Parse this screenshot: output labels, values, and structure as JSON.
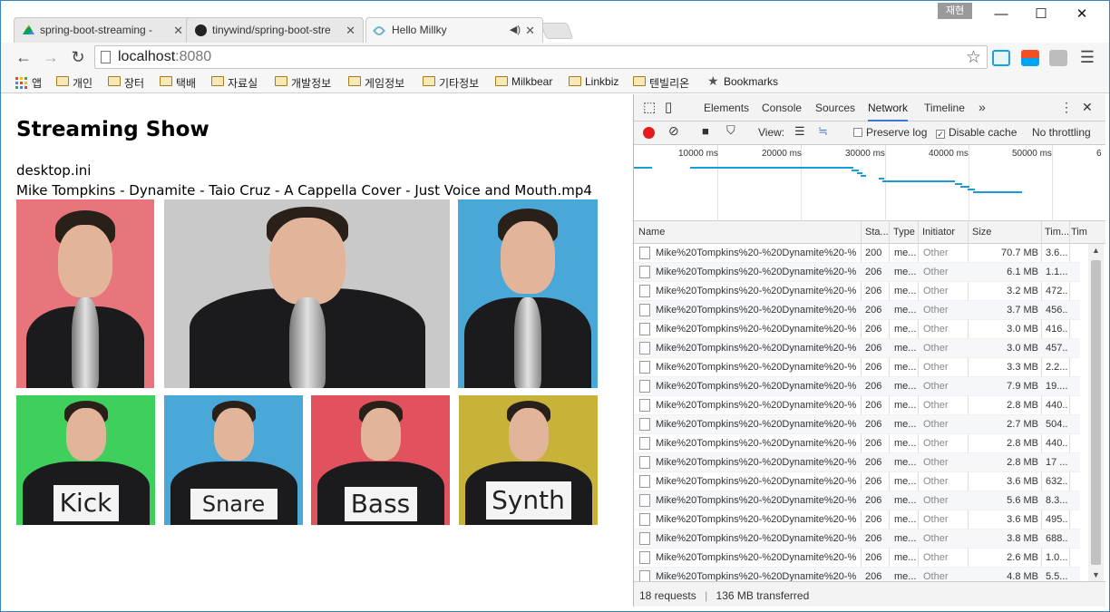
{
  "browser": {
    "tabs": [
      {
        "title": "spring-boot-streaming -",
        "icon_color": "#f2b700"
      },
      {
        "title": "tinywind/spring-boot-stre",
        "icon_color": "#222222"
      },
      {
        "title": "Hello Millky",
        "icon_color": "#6fb3c8"
      }
    ],
    "user_badge": "재현",
    "window_controls": {
      "minimize": "—",
      "maximize": "☐",
      "close": "✕"
    },
    "url_host": "localhost",
    "url_port": ":8080",
    "bookmarks": [
      "앱",
      "개인",
      "장터",
      "택배",
      "자료실",
      "개발정보",
      "게임정보",
      "기타정보",
      "Milkbear",
      "Linkbiz",
      "텐빌리온",
      "Bookmarks"
    ]
  },
  "page": {
    "title": "Streaming Show",
    "files": [
      "desktop.ini",
      "Mike Tompkins - Dynamite - Taio Cruz - A Cappella Cover - Just Voice and Mouth.mp4"
    ],
    "video_signs": [
      "Kick",
      "Snare",
      "Bass",
      "Synth"
    ]
  },
  "devtools": {
    "tabs": [
      "Elements",
      "Console",
      "Sources",
      "Network",
      "Timeline"
    ],
    "active_tab": "Network",
    "toolbar": {
      "view_label": "View:",
      "preserve_log": "Preserve log",
      "disable_cache": "Disable cache",
      "throttling": "No throttling"
    },
    "overview_ticks": [
      "10000 ms",
      "20000 ms",
      "30000 ms",
      "40000 ms",
      "50000 ms",
      "6"
    ],
    "columns": [
      "Name",
      "Sta...",
      "Type",
      "Initiator",
      "Size",
      "Tim...",
      "Time"
    ],
    "requests": [
      {
        "name": "Mike%20Tompkins%20-%20Dynamite%20-%...",
        "status": "200",
        "type": "me...",
        "initiator": "Other",
        "size": "70.7 MB",
        "time": "3.6..."
      },
      {
        "name": "Mike%20Tompkins%20-%20Dynamite%20-%...",
        "status": "206",
        "type": "me...",
        "initiator": "Other",
        "size": "6.1 MB",
        "time": "1.1..."
      },
      {
        "name": "Mike%20Tompkins%20-%20Dynamite%20-%...",
        "status": "206",
        "type": "me...",
        "initiator": "Other",
        "size": "3.2 MB",
        "time": "472..."
      },
      {
        "name": "Mike%20Tompkins%20-%20Dynamite%20-%...",
        "status": "206",
        "type": "me...",
        "initiator": "Other",
        "size": "3.7 MB",
        "time": "456..."
      },
      {
        "name": "Mike%20Tompkins%20-%20Dynamite%20-%...",
        "status": "206",
        "type": "me...",
        "initiator": "Other",
        "size": "3.0 MB",
        "time": "416..."
      },
      {
        "name": "Mike%20Tompkins%20-%20Dynamite%20-%...",
        "status": "206",
        "type": "me...",
        "initiator": "Other",
        "size": "3.0 MB",
        "time": "457..."
      },
      {
        "name": "Mike%20Tompkins%20-%20Dynamite%20-%...",
        "status": "206",
        "type": "me...",
        "initiator": "Other",
        "size": "3.3 MB",
        "time": "2.2..."
      },
      {
        "name": "Mike%20Tompkins%20-%20Dynamite%20-%...",
        "status": "206",
        "type": "me...",
        "initiator": "Other",
        "size": "7.9 MB",
        "time": "19...."
      },
      {
        "name": "Mike%20Tompkins%20-%20Dynamite%20-%...",
        "status": "206",
        "type": "me...",
        "initiator": "Other",
        "size": "2.8 MB",
        "time": "440..."
      },
      {
        "name": "Mike%20Tompkins%20-%20Dynamite%20-%...",
        "status": "206",
        "type": "me...",
        "initiator": "Other",
        "size": "2.7 MB",
        "time": "504..."
      },
      {
        "name": "Mike%20Tompkins%20-%20Dynamite%20-%...",
        "status": "206",
        "type": "me...",
        "initiator": "Other",
        "size": "2.8 MB",
        "time": "440..."
      },
      {
        "name": "Mike%20Tompkins%20-%20Dynamite%20-%...",
        "status": "206",
        "type": "me...",
        "initiator": "Other",
        "size": "2.8 MB",
        "time": "17 ..."
      },
      {
        "name": "Mike%20Tompkins%20-%20Dynamite%20-%...",
        "status": "206",
        "type": "me...",
        "initiator": "Other",
        "size": "3.6 MB",
        "time": "632..."
      },
      {
        "name": "Mike%20Tompkins%20-%20Dynamite%20-%...",
        "status": "206",
        "type": "me...",
        "initiator": "Other",
        "size": "5.6 MB",
        "time": "8.3..."
      },
      {
        "name": "Mike%20Tompkins%20-%20Dynamite%20-%...",
        "status": "206",
        "type": "me...",
        "initiator": "Other",
        "size": "3.6 MB",
        "time": "495..."
      },
      {
        "name": "Mike%20Tompkins%20-%20Dynamite%20-%...",
        "status": "206",
        "type": "me...",
        "initiator": "Other",
        "size": "3.8 MB",
        "time": "688..."
      },
      {
        "name": "Mike%20Tompkins%20-%20Dynamite%20-%...",
        "status": "206",
        "type": "me...",
        "initiator": "Other",
        "size": "2.6 MB",
        "time": "1.0..."
      },
      {
        "name": "Mike%20Tompkins%20-%20Dynamite%20-%...",
        "status": "206",
        "type": "me...",
        "initiator": "Other",
        "size": "4.8 MB",
        "time": "5.5..."
      }
    ],
    "summary_requests": "18 requests",
    "summary_transferred": "136 MB transferred"
  }
}
